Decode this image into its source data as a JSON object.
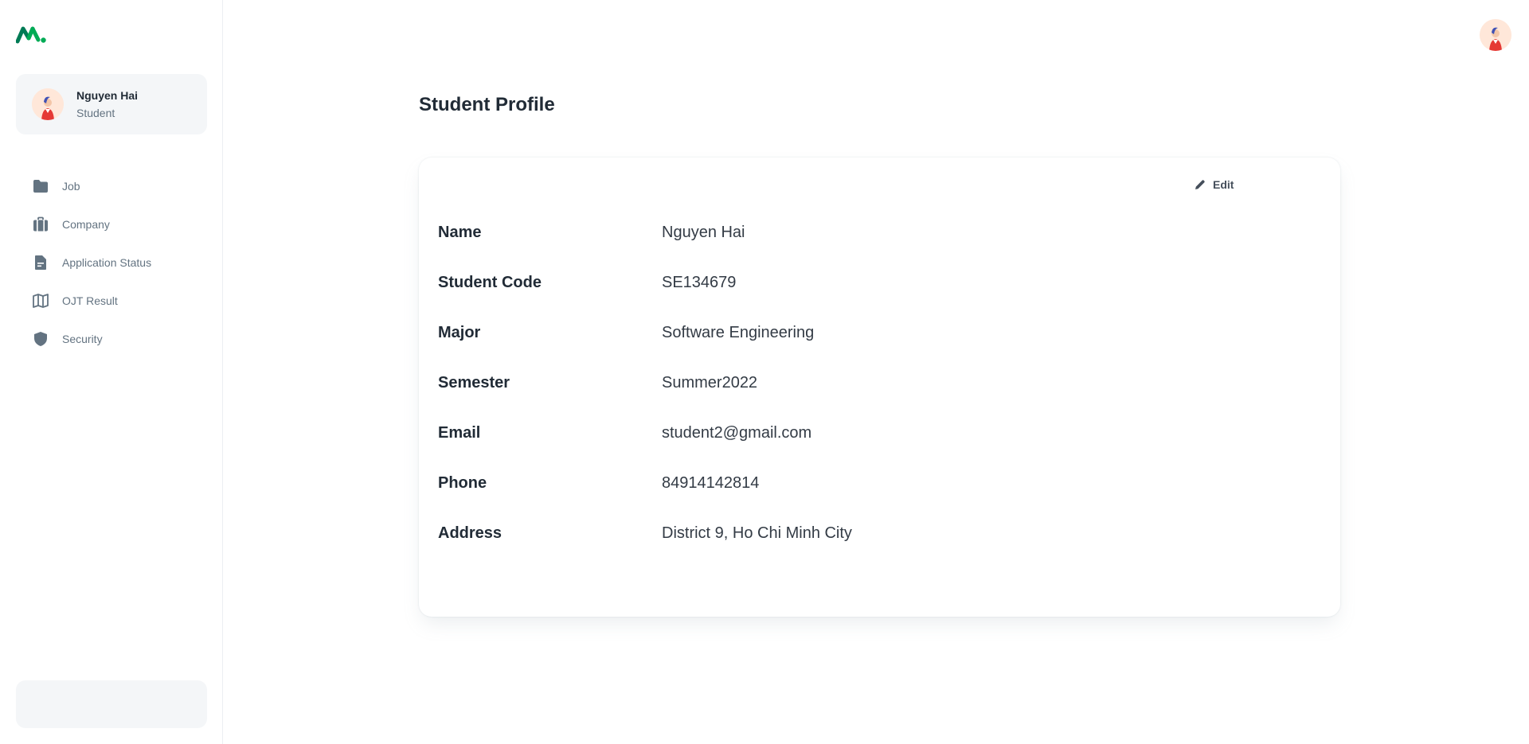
{
  "sidebar": {
    "logo_icon": "brand-logo-icon",
    "account": {
      "name": "Nguyen Hai",
      "role": "Student",
      "avatar_icon": "user-avatar-icon"
    },
    "items": [
      {
        "label": "Job",
        "icon": "folder-icon"
      },
      {
        "label": "Company",
        "icon": "briefcase-icon"
      },
      {
        "label": "Application Status",
        "icon": "document-icon"
      },
      {
        "label": "OJT Result",
        "icon": "map-icon"
      },
      {
        "label": "Security",
        "icon": "shield-icon"
      }
    ]
  },
  "header": {
    "avatar_icon": "user-avatar-icon"
  },
  "main": {
    "title": "Student Profile",
    "edit_label": "Edit",
    "fields": [
      {
        "label": "Name",
        "value": "Nguyen Hai"
      },
      {
        "label": "Student Code",
        "value": "SE134679"
      },
      {
        "label": "Major",
        "value": "Software Engineering"
      },
      {
        "label": "Semester",
        "value": "Summer2022"
      },
      {
        "label": "Email",
        "value": "student2@gmail.com"
      },
      {
        "label": "Phone",
        "value": "84914142814"
      },
      {
        "label": "Address",
        "value": "District 9, Ho Chi Minh City"
      }
    ]
  },
  "colors": {
    "brand_green": "#00ab55",
    "text_primary": "#212b36",
    "text_secondary": "#637381",
    "icon_grey": "#637381",
    "panel_bg": "#f4f6f8",
    "avatar_bg": "#ffe7d9"
  }
}
